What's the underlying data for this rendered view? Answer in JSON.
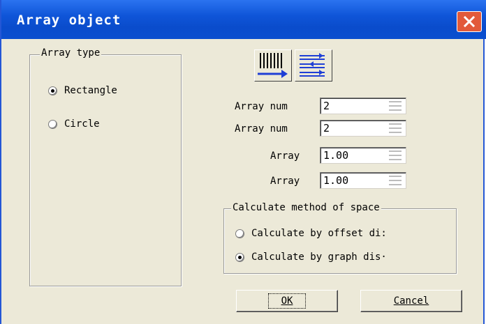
{
  "window": {
    "title": "Array object",
    "close_icon": "close-icon"
  },
  "array_type": {
    "legend": "Array type",
    "options": [
      {
        "label": "Rectangle",
        "checked": true
      },
      {
        "label": "Circle",
        "checked": false
      }
    ]
  },
  "toolbar": {
    "buttons": [
      {
        "icon": "vertical-lines-arrow-icon"
      },
      {
        "icon": "horizontal-lines-arrow-icon"
      }
    ]
  },
  "fields": [
    {
      "label": "Array num",
      "value": "2"
    },
    {
      "label": "Array num",
      "value": "2"
    },
    {
      "label": "Array",
      "value": "1.00"
    },
    {
      "label": "Array",
      "value": "1.00"
    }
  ],
  "calc_method": {
    "legend": "Calculate method of space",
    "options": [
      {
        "label": "Calculate by offset di:",
        "checked": false
      },
      {
        "label": "Calculate by graph dis·",
        "checked": true
      }
    ]
  },
  "buttons": {
    "ok_label": "OK",
    "cancel_label": "Cancel"
  },
  "colors": {
    "titlebar": "#0b4fcf",
    "close": "#e25a3a",
    "face": "#ece9d8",
    "accent_arrow": "#1f3fd6"
  }
}
